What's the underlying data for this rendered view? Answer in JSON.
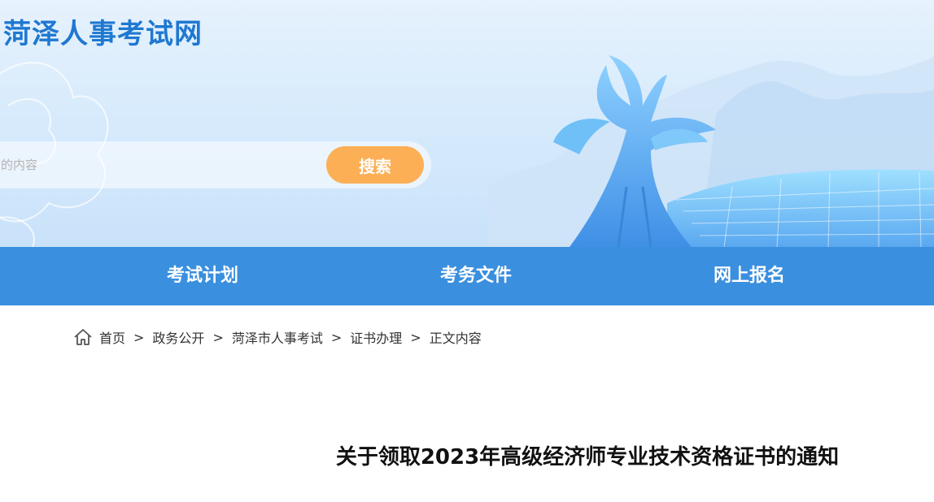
{
  "header": {
    "site_title": "菏泽人事考试网",
    "search": {
      "placeholder": "索的内容",
      "value": "",
      "button_label": "搜索"
    }
  },
  "nav": {
    "items": [
      {
        "label": "考试计划"
      },
      {
        "label": "考务文件"
      },
      {
        "label": "网上报名"
      }
    ]
  },
  "breadcrumb": {
    "home_icon": "home-icon",
    "items": [
      {
        "label": "首页"
      },
      {
        "label": "政务公开"
      },
      {
        "label": "菏泽市人事考试"
      },
      {
        "label": "证书办理"
      },
      {
        "label": "正文内容"
      }
    ],
    "separator": ">"
  },
  "article": {
    "title": "关于领取2023年高级经济师专业技术资格证书的通知"
  },
  "colors": {
    "brand_blue": "#1f78d1",
    "nav_blue": "#3a8fde",
    "search_orange": "#fcaf55"
  }
}
